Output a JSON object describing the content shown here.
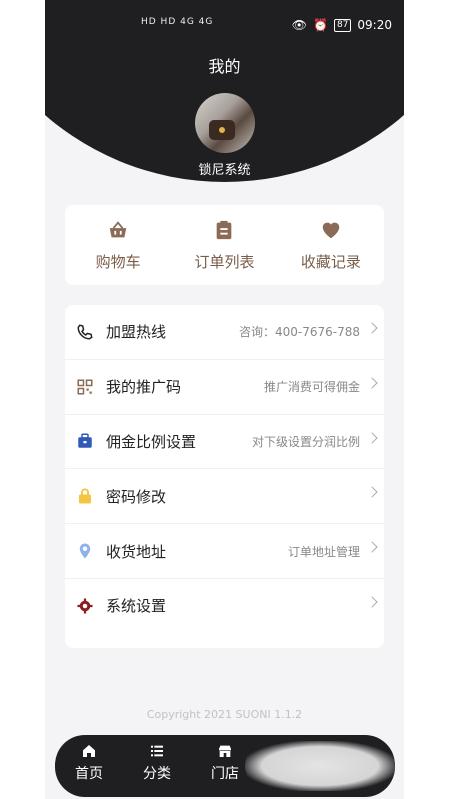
{
  "status": {
    "signal_text": "HD HD 4G 4G",
    "battery": "87",
    "time": "09:20"
  },
  "header": {
    "title": "我的",
    "user_name": "锁尼系统"
  },
  "quick_actions": [
    {
      "icon": "basket-icon",
      "label": "购物车"
    },
    {
      "icon": "clipboard-icon",
      "label": "订单列表"
    },
    {
      "icon": "heart-icon",
      "label": "收藏记录"
    }
  ],
  "menu": [
    {
      "icon": "phone-icon",
      "label": "加盟热线",
      "hint": "咨询：400-7676-788"
    },
    {
      "icon": "qr-code-icon",
      "label": "我的推广码",
      "hint": "推广消费可得佣金"
    },
    {
      "icon": "briefcase-icon",
      "label": "佣金比例设置",
      "hint": "对下级设置分润比例"
    },
    {
      "icon": "lock-icon",
      "label": "密码修改",
      "hint": ""
    },
    {
      "icon": "location-pin-icon",
      "label": "收货地址",
      "hint": "订单地址管理"
    },
    {
      "icon": "gear-icon",
      "label": "系统设置",
      "hint": ""
    }
  ],
  "footer": {
    "copyright": "Copyright 2021 SUONI 1.1.2"
  },
  "tabbar": [
    {
      "icon": "home-icon",
      "label": "首页"
    },
    {
      "icon": "list-icon",
      "label": "分类"
    },
    {
      "icon": "store-icon",
      "label": "门店"
    }
  ],
  "colors": {
    "dark": "#1f1f22",
    "accent_brown": "#7a5e4b",
    "background": "#f4f4f6"
  }
}
